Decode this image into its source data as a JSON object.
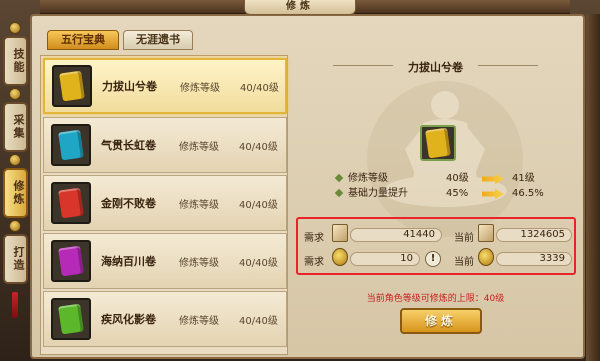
{
  "window": {
    "title": "修炼"
  },
  "side_tabs": [
    {
      "label": "技能",
      "active": false
    },
    {
      "label": "采集",
      "active": false
    },
    {
      "label": "修炼",
      "active": true
    },
    {
      "label": "打造",
      "active": false
    }
  ],
  "sub_tabs": [
    {
      "label": "五行宝典",
      "active": true
    },
    {
      "label": "无涯遗书",
      "active": false
    }
  ],
  "books": [
    {
      "name": "力拔山兮卷",
      "stat_label": "修炼等级",
      "stat_value": "40/40级",
      "color": "#e0b21c",
      "selected": true
    },
    {
      "name": "气贯长虹卷",
      "stat_label": "修炼等级",
      "stat_value": "40/40级",
      "color": "#1fa6c4",
      "selected": false
    },
    {
      "name": "金刚不败卷",
      "stat_label": "修炼等级",
      "stat_value": "40/40级",
      "color": "#d8362a",
      "selected": false
    },
    {
      "name": "海纳百川卷",
      "stat_label": "修炼等级",
      "stat_value": "40/40级",
      "color": "#b62ab8",
      "selected": false
    },
    {
      "name": "疾风化影卷",
      "stat_label": "修炼等级",
      "stat_value": "40/40级",
      "color": "#5cb82a",
      "selected": false
    }
  ],
  "detail": {
    "title": "力拔山兮卷",
    "book_color": "#e0b21c",
    "stats": [
      {
        "label": "修炼等级",
        "current": "40级",
        "next": "41级"
      },
      {
        "label": "基础力量提升",
        "current": "45%",
        "next": "46.5%"
      }
    ],
    "requirements": [
      {
        "label": "需求",
        "value": "41440",
        "current_label": "当前",
        "current_value": "1324605",
        "icon": "scroll-icon"
      },
      {
        "label": "需求",
        "value": "10",
        "current_label": "当前",
        "current_value": "3339",
        "icon": "coin-icon"
      }
    ],
    "limit_note": "当前角色等级可修炼的上限：40级",
    "button_label": "修炼"
  }
}
